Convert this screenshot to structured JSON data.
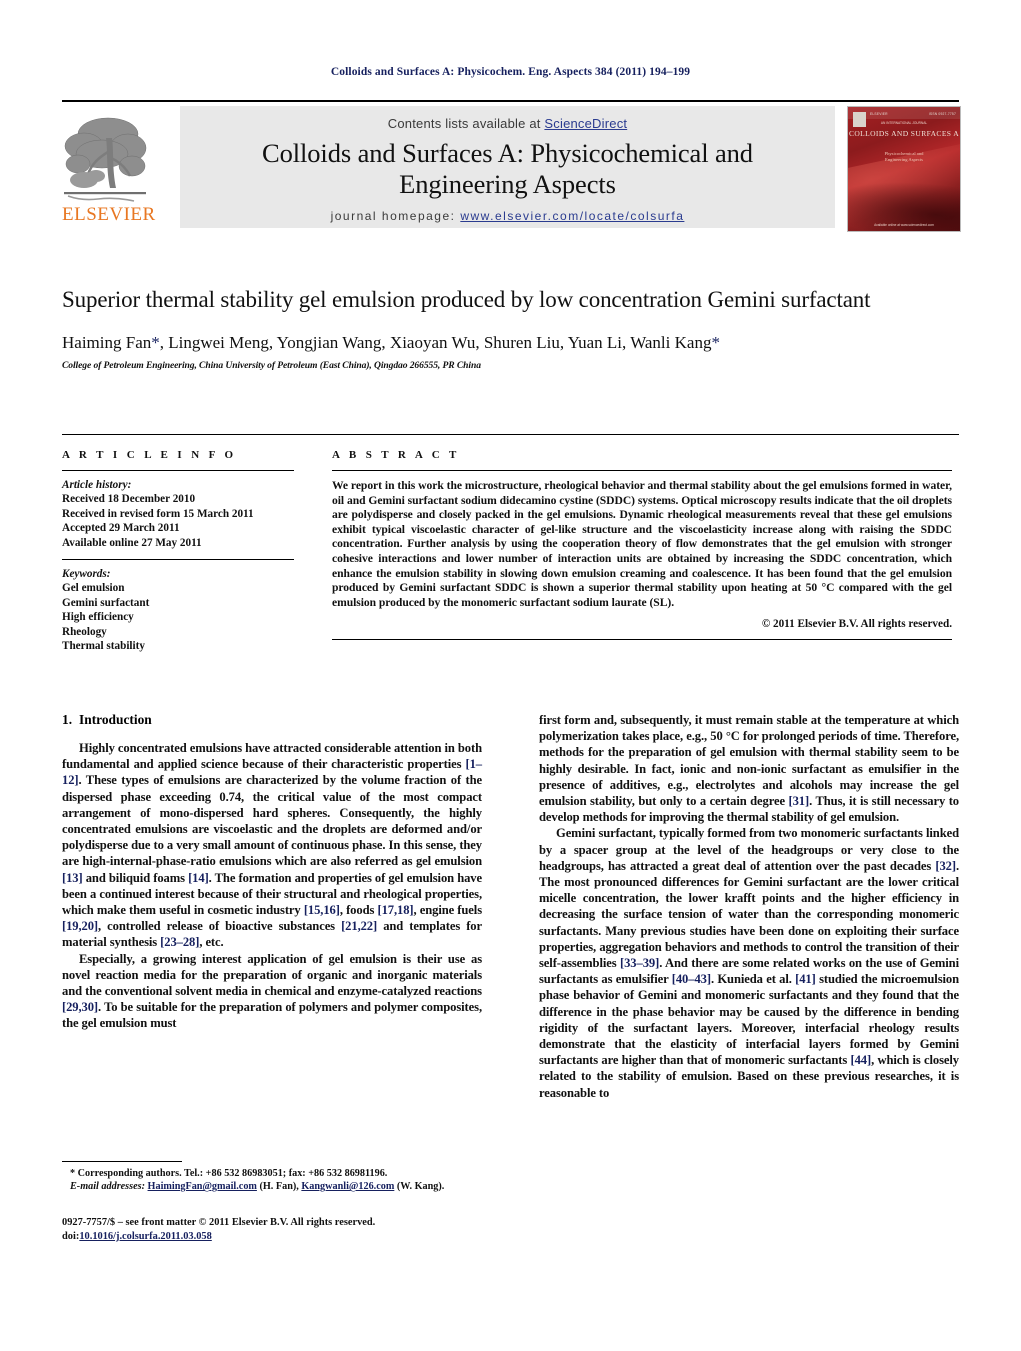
{
  "running_head": "Colloids and Surfaces A: Physicochem. Eng. Aspects 384 (2011) 194–199",
  "masthead": {
    "contents_prefix": "Contents lists available at ",
    "sciencedirect": "ScienceDirect",
    "journal_title_line1": "Colloids and Surfaces A: Physicochemical and",
    "journal_title_line2": "Engineering Aspects",
    "homepage_label": "journal homepage:",
    "homepage_url": "www.elsevier.com/locate/colsurfa",
    "publisher_logo_text": "ELSEVIER",
    "publisher_logo_icon": "elsevier-tree-logo",
    "cover": {
      "title": "COLLOIDS AND SURFACES A",
      "subtitle_line1": "Physicochemical and",
      "subtitle_line2": "Engineering Aspects",
      "eyebrow": "AN INTERNATIONAL JOURNAL",
      "top_left": "ELSEVIER",
      "top_right": "ISSN 0927-7757",
      "bottom": "Available online at www.sciencedirect.com"
    },
    "accent_link_color": "#2a3b8f"
  },
  "article": {
    "title": "Superior thermal stability gel emulsion produced by low concentration Gemini surfactant",
    "authors": "Haiming Fan*, Lingwei Meng, Yongjian Wang, Xiaoyan Wu, Shuren Liu, Yuan Li, Wanli Kang*",
    "affiliation": "College of Petroleum Engineering, China University of Petroleum (East China), Qingdao 266555, PR China"
  },
  "article_info": {
    "heading": "A R T I C L E    I N F O",
    "history_label": "Article history:",
    "history": [
      "Received 18 December 2010",
      "Received in revised form 15 March 2011",
      "Accepted 29 March 2011",
      "Available online 27 May 2011"
    ],
    "keywords_label": "Keywords:",
    "keywords": [
      "Gel emulsion",
      "Gemini surfactant",
      "High efficiency",
      "Rheology",
      "Thermal stability"
    ]
  },
  "abstract": {
    "heading": "A B S T R A C T",
    "text": "We report in this work the microstructure, rheological behavior and thermal stability about the gel emulsions formed in water, oil and Gemini surfactant sodium didecamino cystine (SDDC) systems. Optical microscopy results indicate that the oil droplets are polydisperse and closely packed in the gel emulsions. Dynamic rheological measurements reveal that these gel emulsions exhibit typical viscoelastic character of gel-like structure and the viscoelasticity increase along with raising the SDDC concentration. Further analysis by using the cooperation theory of flow demonstrates that the gel emulsion with stronger cohesive interactions and lower number of interaction units are obtained by increasing the SDDC concentration, which enhance the emulsion stability in slowing down emulsion creaming and coalescence. It has been found that the gel emulsion produced by Gemini surfactant SDDC is shown a superior thermal stability upon heating at 50 °C compared with the gel emulsion produced by the monomeric surfactant sodium laurate (SL).",
    "copyright": "© 2011 Elsevier B.V. All rights reserved."
  },
  "introduction": {
    "number": "1.",
    "title": "Introduction",
    "left_paragraphs": [
      "Highly concentrated emulsions have attracted considerable attention in both fundamental and applied science because of their characteristic properties [1–12]. These types of emulsions are characterized by the volume fraction of the dispersed phase exceeding 0.74, the critical value of the most compact arrangement of mono-dispersed hard spheres. Consequently, the highly concentrated emulsions are viscoelastic and the droplets are deformed and/or polydisperse due to a very small amount of continuous phase. In this sense, they are high-internal-phase-ratio emulsions which are also referred as gel emulsion [13] and biliquid foams [14]. The formation and properties of gel emulsion have been a continued interest because of their structural and rheological properties, which make them useful in cosmetic industry [15,16], foods [17,18], engine fuels [19,20], controlled release of bioactive substances [21,22] and templates for material synthesis [23–28], etc.",
      "Especially, a growing interest application of gel emulsion is their use as novel reaction media for the preparation of organic and inorganic materials and the conventional solvent media in chemical and enzyme-catalyzed reactions [29,30]. To be suitable for the preparation of polymers and polymer composites, the gel emulsion must"
    ],
    "right_paragraphs": [
      "first form and, subsequently, it must remain stable at the temperature at which polymerization takes place, e.g., 50 °C for prolonged periods of time. Therefore, methods for the preparation of gel emulsion with thermal stability seem to be highly desirable. In fact, ionic and non-ionic surfactant as emulsifier in the presence of additives, e.g., electrolytes and alcohols may increase the gel emulsion stability, but only to a certain degree [31]. Thus, it is still necessary to develop methods for improving the thermal stability of gel emulsion.",
      "Gemini surfactant, typically formed from two monomeric surfactants linked by a spacer group at the level of the headgroups or very close to the headgroups, has attracted a great deal of attention over the past decades [32]. The most pronounced differences for Gemini surfactant are the lower critical micelle concentration, the lower krafft points and the higher efficiency in decreasing the surface tension of water than the corresponding monomeric surfactants. Many previous studies have been done on exploiting their surface properties, aggregation behaviors and methods to control the transition of their self-assemblies [33–39]. And there are some related works on the use of Gemini surfactants as emulsifier [40–43]. Kunieda et al. [41] studied the microemulsion phase behavior of Gemini and monomeric surfactants and they found that the difference in the phase behavior may be caused by the difference in bending rigidity of the surfactant layers. Moreover, interfacial rheology results demonstrate that the elasticity of interfacial layers formed by Gemini surfactants are higher than that of monomeric surfactants [44], which is closely related to the stability of emulsion. Based on these previous researches, it is reasonable to"
    ]
  },
  "footnotes": {
    "corresponding": "* Corresponding authors. Tel.: +86 532 86983051; fax: +86 532 86981196.",
    "email_label": "E-mail addresses:",
    "email1": "HaimingFan@gmail.com",
    "email1_owner": "(H. Fan),",
    "email2": "Kangwanli@126.com",
    "email2_owner": "(W. Kang).",
    "imprint": "0927-7757/$ – see front matter © 2011 Elsevier B.V. All rights reserved.",
    "doi_label": "doi:",
    "doi_value": "10.1016/j.colsurfa.2011.03.058"
  }
}
